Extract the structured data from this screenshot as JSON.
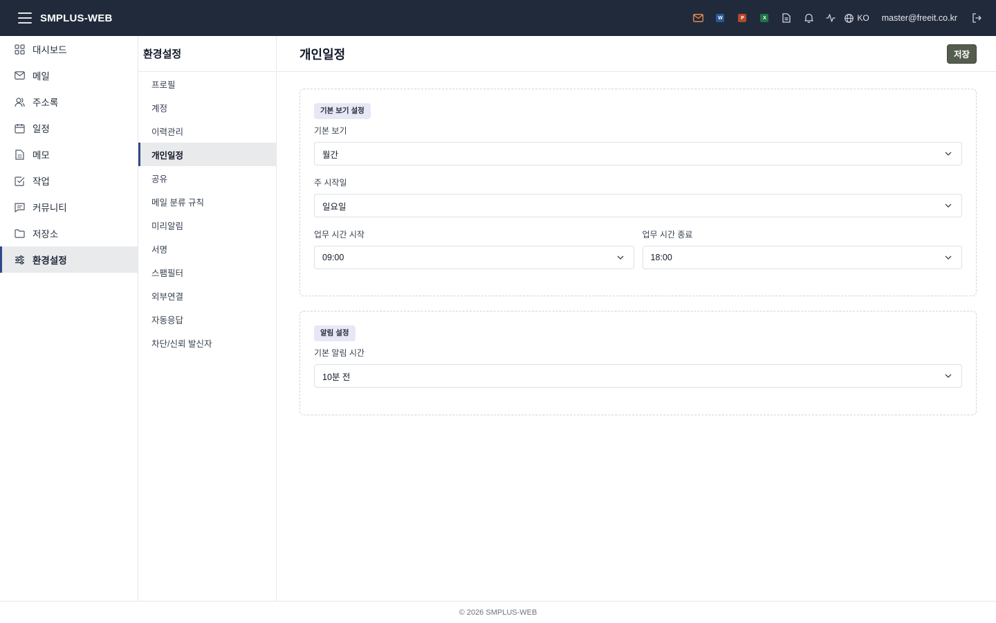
{
  "app": {
    "title": "SMPLUS-WEB"
  },
  "topbar": {
    "icons": [
      "mail-icon",
      "word-icon",
      "powerpoint-icon",
      "excel-icon",
      "document-icon",
      "bell-icon",
      "activity-icon",
      "globe-icon",
      "logout-icon"
    ],
    "word_badge": "W",
    "ppt_badge": "P",
    "excel_badge": "X",
    "language": "KO",
    "user_email": "master@freeit.co.kr"
  },
  "sidebar": {
    "items": [
      {
        "label": "대시보드",
        "icon": "dashboard-icon"
      },
      {
        "label": "메일",
        "icon": "mail-icon"
      },
      {
        "label": "주소록",
        "icon": "contacts-icon"
      },
      {
        "label": "일정",
        "icon": "calendar-icon"
      },
      {
        "label": "메모",
        "icon": "memo-icon"
      },
      {
        "label": "작업",
        "icon": "task-icon"
      },
      {
        "label": "커뮤니티",
        "icon": "community-icon"
      },
      {
        "label": "저장소",
        "icon": "folder-icon"
      },
      {
        "label": "환경설정",
        "icon": "settings-sliders-icon",
        "active": true
      }
    ]
  },
  "submenu": {
    "title": "환경설정",
    "items": [
      "프로필",
      "계정",
      "이력관리",
      "개인일정",
      "공유",
      "메일 분류 규칙",
      "미리알림",
      "서명",
      "스팸필터",
      "외부연결",
      "자동응답",
      "차단/신뢰 발신자"
    ],
    "active_index": 3
  },
  "main": {
    "title": "개인일정",
    "save_label": "저장",
    "view_section": {
      "chip": "기본 보기 설정",
      "default_view_label": "기본 보기",
      "default_view_value": "월간",
      "week_start_label": "주 시작일",
      "week_start_value": "일요일",
      "work_start_label": "업무 시간 시작",
      "work_start_value": "09:00",
      "work_end_label": "업무 시간 종료",
      "work_end_value": "18:00"
    },
    "alarm_section": {
      "chip": "알림 설정",
      "default_alarm_label": "기본 알림 시간",
      "default_alarm_value": "10분 전"
    }
  },
  "footer": {
    "text": "© 2026 SMPLUS-WEB"
  },
  "colors": {
    "topbar_bg": "#212a3b",
    "active_bar": "#2f4a8a",
    "save_button": "#555d4f",
    "chip_bg": "#e8e7f5",
    "word": "#2b579a",
    "powerpoint": "#b7472a",
    "excel": "#217346",
    "mail_icon": "#e8894a"
  }
}
